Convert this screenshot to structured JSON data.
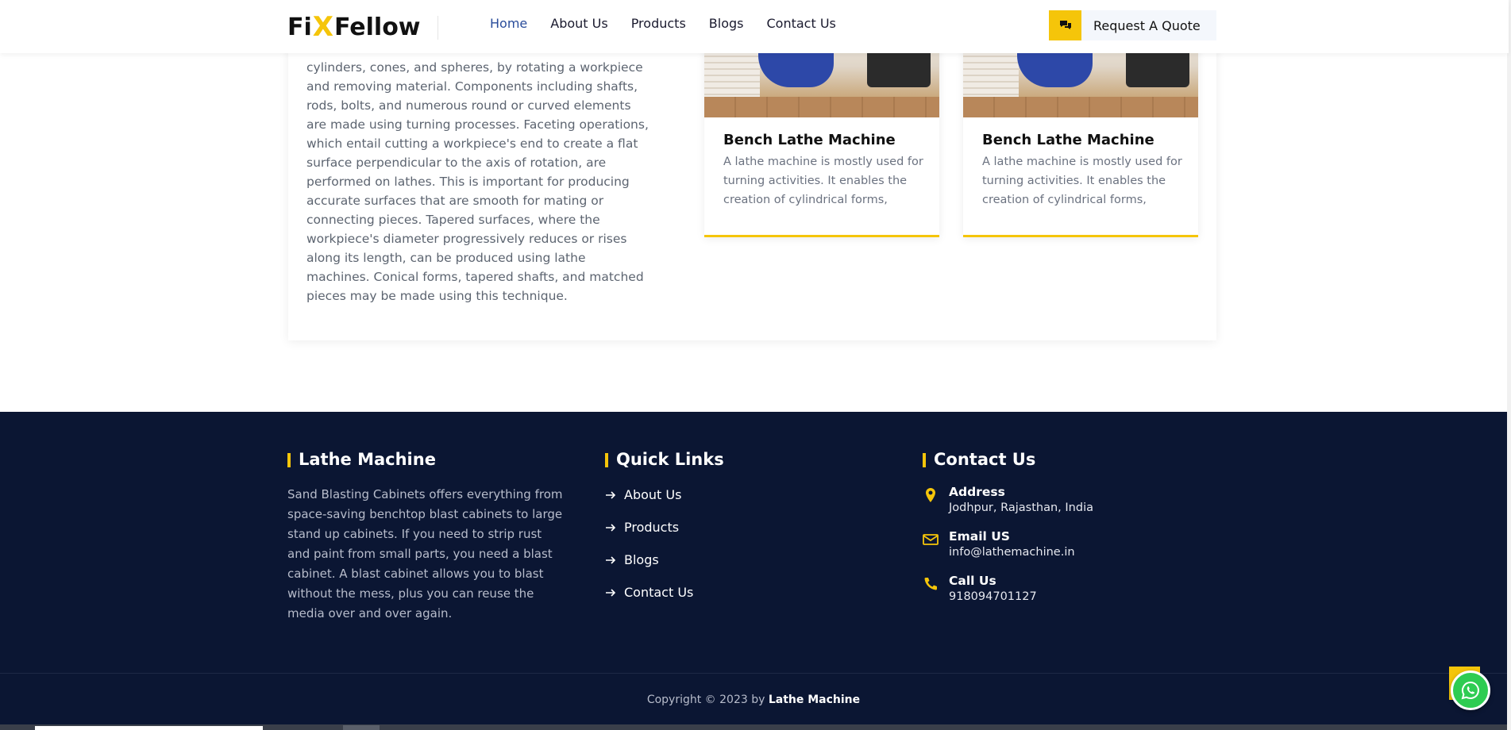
{
  "header": {
    "logo": {
      "part1": "Fi",
      "part2": "X",
      "part3": "Fellow"
    },
    "nav": [
      {
        "label": "Home",
        "active": true
      },
      {
        "label": "About Us",
        "active": false
      },
      {
        "label": "Products",
        "active": false
      },
      {
        "label": "Blogs",
        "active": false
      },
      {
        "label": "Contact Us",
        "active": false
      }
    ],
    "quote_button": "Request A Quote"
  },
  "content": {
    "description": "cylinders, cones, and spheres, by rotating a workpiece and removing material. Components including shafts, rods, bolts, and numerous round or curved elements are made using turning processes. Faceting operations, which entail cutting a workpiece's end to create a flat surface perpendicular to the axis of rotation, are performed on lathes. This is important for producing accurate surfaces that are smooth for mating or connecting pieces. Tapered surfaces, where the workpiece's diameter progressively reduces or rises along its length, can be produced using lathe machines. Conical forms, tapered shafts, and matched pieces may be made using this technique.",
    "products": [
      {
        "title": "Bench Lathe Machine",
        "text": "A lathe machine is mostly used for turning activities. It enables the creation of cylindrical forms, such..."
      },
      {
        "title": "Bench Lathe Machine",
        "text": "A lathe machine is mostly used for turning activities. It enables the creation of cylindrical forms, such..."
      }
    ]
  },
  "footer": {
    "about": {
      "title": "Lathe Machine",
      "text": "Sand Blasting Cabinets offers everything from space-saving benchtop blast cabinets to large stand up cabinets. If you need to strip rust and paint from small parts, you need a blast cabinet. A blast cabinet allows you to blast without the mess, plus you can reuse the media over and over again."
    },
    "quick_links": {
      "title": "Quick Links",
      "items": [
        "About Us",
        "Products",
        "Blogs",
        "Contact Us"
      ]
    },
    "contact": {
      "title": "Contact Us",
      "address_label": "Address",
      "address": "Jodhpur, Rajasthan, India",
      "email_label": "Email US",
      "email": "info@lathemachine.in",
      "call_label": "Call Us",
      "phone": "918094701127"
    },
    "copyright_prefix": "Copyright © 2023 by",
    "copyright_name": "Lathe Machine"
  },
  "colors": {
    "accent": "#f5c50a",
    "nav_active": "#2a4d9b",
    "footer_bg": "#0b1633",
    "whatsapp": "#2ecc52"
  },
  "icons": {
    "quote": "chat-bubbles-icon",
    "link_arrow": "arrow-right-icon",
    "address": "map-pin-icon",
    "email": "envelope-icon",
    "call": "phone-icon",
    "float": "whatsapp-icon"
  }
}
